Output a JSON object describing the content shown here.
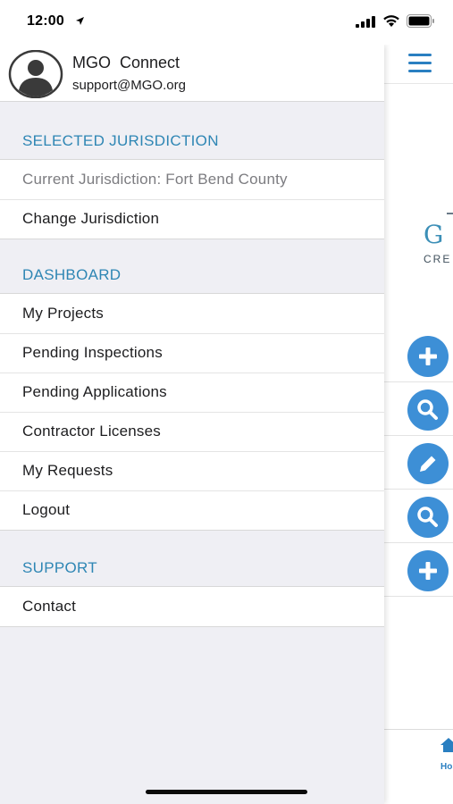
{
  "status_bar": {
    "time": "12:00"
  },
  "drawer": {
    "profile": {
      "name": "MGO  Connect",
      "email": "support@MGO.org"
    },
    "sections": {
      "jurisdiction": {
        "header": "SELECTED JURISDICTION",
        "current": "Current Jurisdiction: Fort Bend County",
        "change": "Change Jurisdiction"
      },
      "dashboard": {
        "header": "DASHBOARD",
        "items": [
          "My Projects",
          "Pending Inspections",
          "Pending Applications",
          "Contractor Licenses",
          "My Requests",
          "Logout"
        ]
      },
      "support": {
        "header": "SUPPORT",
        "items": [
          "Contact"
        ]
      }
    }
  },
  "background_app": {
    "logo_letter": "G",
    "logo_text": "CRE",
    "tab_home_label": "Ho",
    "accent_color": "#3d8fd6",
    "actions": [
      "plus-icon",
      "search-icon",
      "pencil-icon",
      "search-icon",
      "plus-icon"
    ]
  }
}
